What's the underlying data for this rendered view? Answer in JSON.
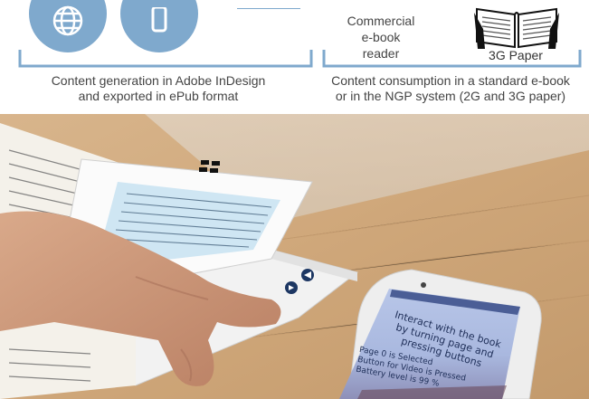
{
  "diagram": {
    "left_caption_line1": "Content generation in Adobe InDesign",
    "left_caption_line2": "and exported in ePub format",
    "right_caption_line1": "Content consumption in a standard e-book",
    "right_caption_line2": "or in the NGP system (2G and 3G paper)",
    "reader_label_line1": "Commercial",
    "reader_label_line2": "e-book",
    "reader_label_line3": "reader",
    "paper_label": "3G Paper",
    "accent_color": "#7fa9cd"
  },
  "photo": {
    "phone_screen": {
      "instruction_line1": "Interact with the book",
      "instruction_line2": "by turning page and",
      "instruction_line3": "pressing buttons",
      "status_line1": "Page 0 is Selected",
      "status_line2": "Button for Video is Pressed",
      "status_line3": "Battery level is 99 %"
    }
  }
}
